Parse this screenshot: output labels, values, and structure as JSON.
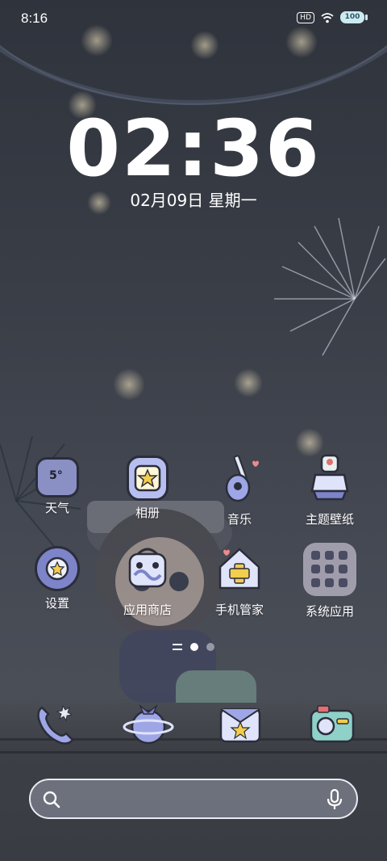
{
  "status_bar": {
    "time": "8:16",
    "network_badge": "HD",
    "battery": "100",
    "wifi_icon": "wifi-icon"
  },
  "lockclock": {
    "time": "02:36",
    "date": "02月09日 星期一"
  },
  "apps": [
    {
      "label": "天气",
      "icon": "weather-icon",
      "weather_text": "5°"
    },
    {
      "label": "相册",
      "icon": "gallery-icon"
    },
    {
      "label": "音乐",
      "icon": "music-icon"
    },
    {
      "label": "主题壁纸",
      "icon": "theme-icon"
    },
    {
      "label": "设置",
      "icon": "settings-icon"
    },
    {
      "label": "应用商店",
      "icon": "app-store-icon"
    },
    {
      "label": "手机管家",
      "icon": "phone-manager-icon"
    },
    {
      "label": "系统应用",
      "icon": "system-apps-folder-icon"
    }
  ],
  "page_indicator": {
    "pages": 2,
    "current": 1
  },
  "dock": [
    {
      "icon": "phone-icon"
    },
    {
      "icon": "browser-icon"
    },
    {
      "icon": "messages-icon"
    },
    {
      "icon": "camera-icon"
    }
  ],
  "search": {
    "placeholder": ""
  },
  "colors": {
    "accent": "#8a8fc4",
    "search_border": "#e9ebf2"
  }
}
